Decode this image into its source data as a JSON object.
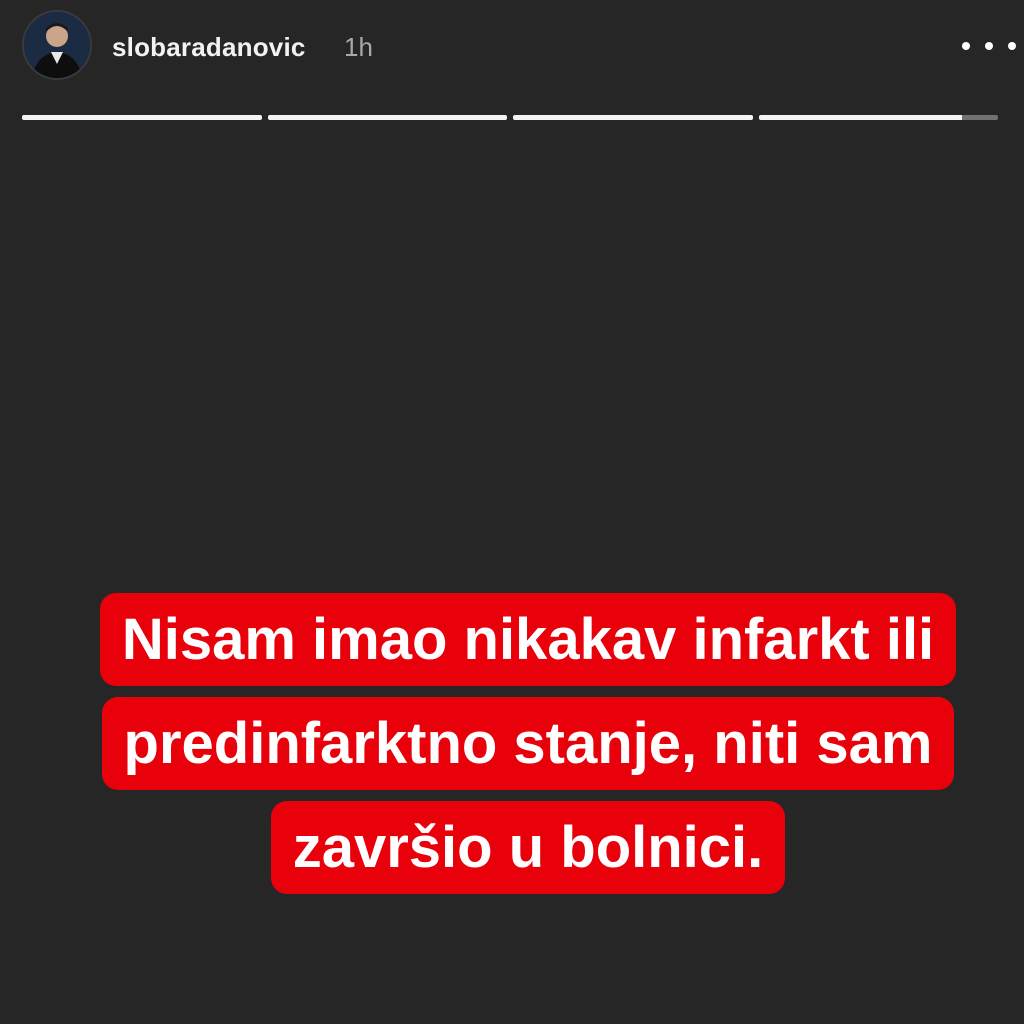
{
  "header": {
    "username": "slobaradanovic",
    "timestamp": "1h",
    "avatar_icon": "profile-avatar",
    "more_icon": "more-options-icon"
  },
  "progress": {
    "segments": [
      {
        "fill": 1.0
      },
      {
        "fill": 1.0
      },
      {
        "fill": 1.0
      },
      {
        "fill": 0.85
      }
    ]
  },
  "story": {
    "background_color": "#262626",
    "caption": "Nisam imao nikakav infarkt ili predinfarktno stanje, niti sam završio u bolnici.",
    "caption_bg_color": "#e8000b",
    "caption_text_color": "#ffffff"
  }
}
